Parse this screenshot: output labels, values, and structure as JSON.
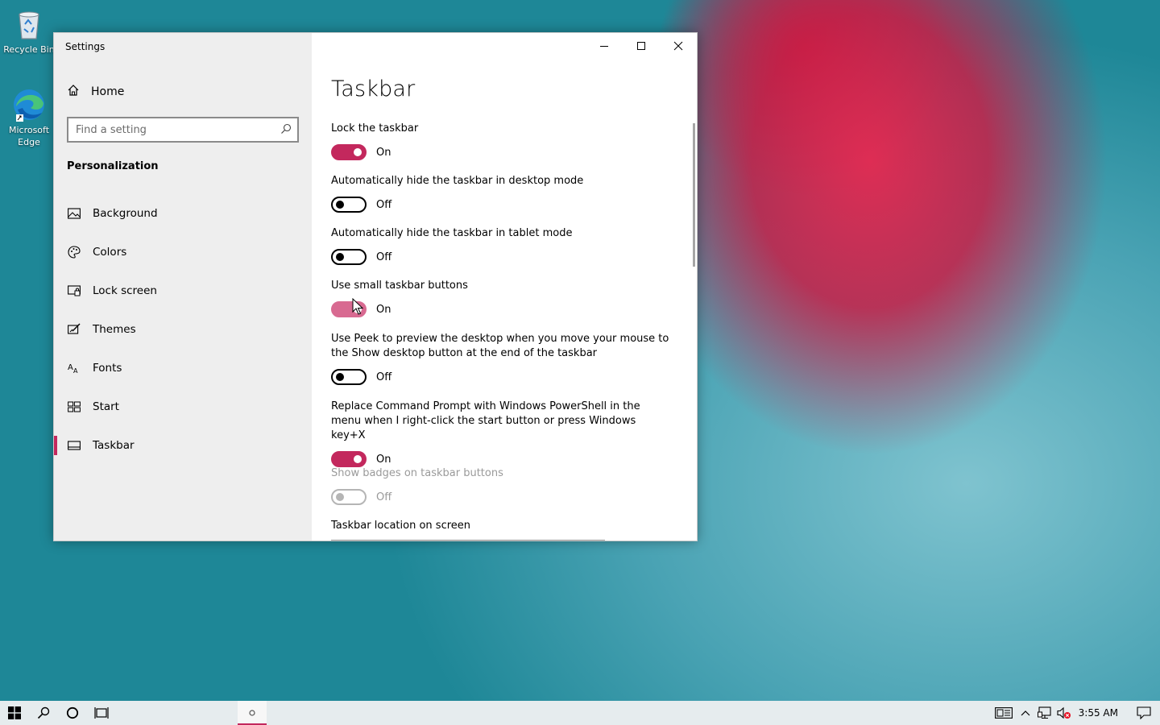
{
  "desktop": {
    "icons": [
      {
        "label": "Recycle Bin"
      },
      {
        "label": "Microsoft Edge"
      }
    ]
  },
  "window": {
    "title": "Settings",
    "controls": {
      "minimize": "minimize-icon",
      "maximize": "maximize-icon",
      "close": "close-icon"
    }
  },
  "sidebar": {
    "home_label": "Home",
    "search_placeholder": "Find a setting",
    "section_title": "Personalization",
    "items": [
      {
        "label": "Background",
        "icon": "picture-icon"
      },
      {
        "label": "Colors",
        "icon": "palette-icon"
      },
      {
        "label": "Lock screen",
        "icon": "lock-screen-icon"
      },
      {
        "label": "Themes",
        "icon": "themes-icon"
      },
      {
        "label": "Fonts",
        "icon": "fonts-icon"
      },
      {
        "label": "Start",
        "icon": "start-icon"
      },
      {
        "label": "Taskbar",
        "icon": "taskbar-icon",
        "active": true
      }
    ]
  },
  "page": {
    "title": "Taskbar",
    "settings": [
      {
        "label": "Lock the taskbar",
        "state": "On"
      },
      {
        "label": "Automatically hide the taskbar in desktop mode",
        "state": "Off"
      },
      {
        "label": "Automatically hide the taskbar in tablet mode",
        "state": "Off"
      },
      {
        "label": "Use small taskbar buttons",
        "state": "On"
      },
      {
        "label": "Use Peek to preview the desktop when you move your mouse to the Show desktop button at the end of the taskbar",
        "state": "Off"
      },
      {
        "label": "Replace Command Prompt with Windows PowerShell in the menu when I right-click the start button or press Windows key+X",
        "state": "On"
      },
      {
        "label": "Show badges on taskbar buttons",
        "state": "Off",
        "disabled": true
      }
    ],
    "location_label": "Taskbar location on screen"
  },
  "taskbar": {
    "clock": "3:55 AM"
  },
  "colors": {
    "accent": "#c3285d",
    "sidebar_bg": "#eeeeee",
    "taskbar_bg": "#e6ecee"
  }
}
